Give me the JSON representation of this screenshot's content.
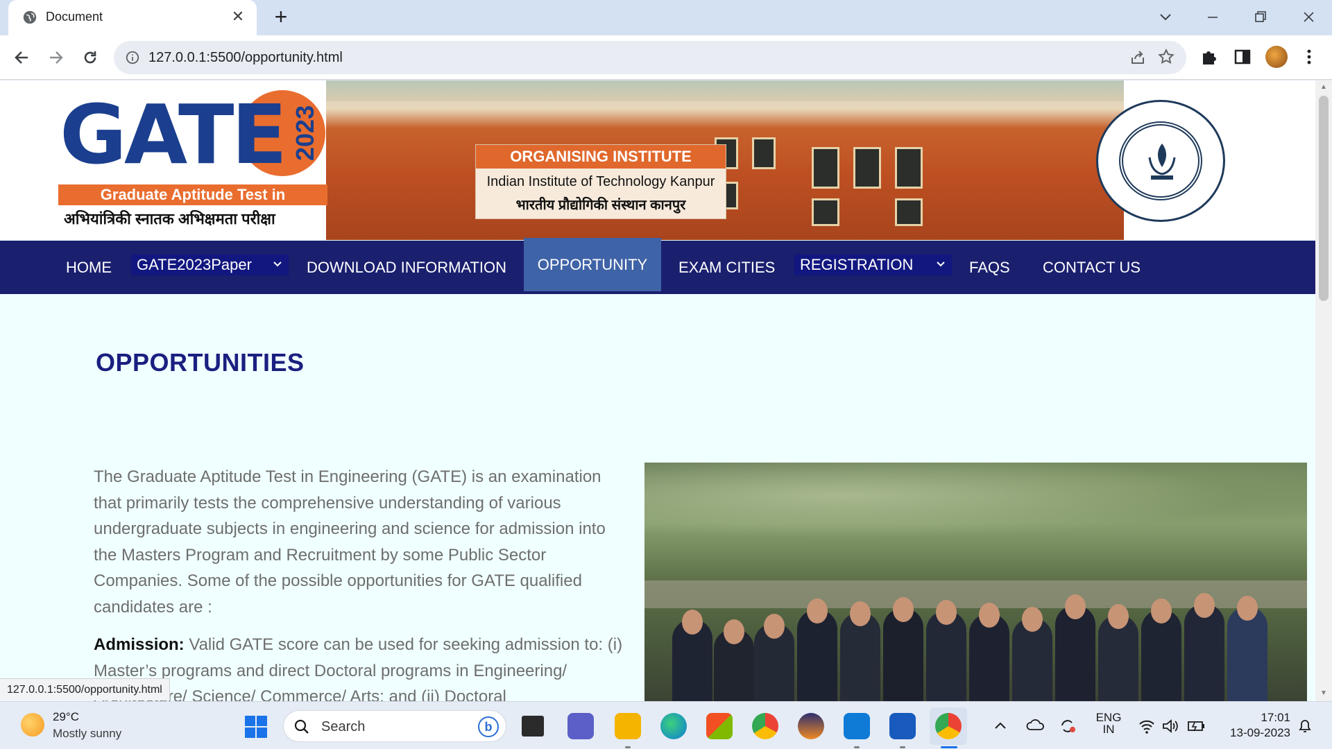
{
  "browser": {
    "tab_title": "Document",
    "url": "127.0.0.1:5500/opportunity.html",
    "status_url": "127.0.0.1:5500/opportunity.html"
  },
  "banner": {
    "logo_word": "GATE",
    "logo_year": "2023",
    "logo_subtitle": "Graduate Aptitude Test in Engineering",
    "logo_hindi": "अभियांत्रिकी स्नातक अभिक्षमता परीक्षा",
    "org_heading": "ORGANISING INSTITUTE",
    "org_name_en": "Indian Institute of Technology Kanpur",
    "org_name_hi": "भारतीय प्रौद्योगिकी संस्थान कानपुर"
  },
  "nav": {
    "home": "HOME",
    "paper": "GATE2023Paper",
    "download": "DOWNLOAD INFORMATION",
    "opportunity": "OPPORTUNITY",
    "cities": "EXAM CITIES",
    "registration": "REGISTRATION",
    "faqs": "FAQS",
    "contact": "CONTACT US"
  },
  "content": {
    "heading": "OPPORTUNITIES",
    "intro": "The Graduate Aptitude Test in Engineering (GATE) is an examination that primarily tests the comprehensive understanding of various undergraduate subjects in engineering and science for admission into the Masters Program and Recruitment by some Public Sector Companies. Some of the possible opportunities for GATE qualified candidates are :",
    "admission_label": "Admission:",
    "admission_text": " Valid GATE score can be used for seeking admission to: (i) Master’s programs and direct Doctoral programs in Engineering/ Architecture/ Science/ Commerce/ Arts; and (ii) Doctoral"
  },
  "taskbar": {
    "weather_temp": "29°C",
    "weather_desc": "Mostly sunny",
    "search_label": "Search",
    "lang_top": "ENG",
    "lang_bottom": "IN",
    "time": "17:01",
    "date": "13-09-2023"
  },
  "colors": {
    "nav_bg": "#1a1f6e",
    "nav_active": "#3f63a7",
    "heading": "#1a1f80",
    "page_bg": "#f0ffff",
    "accent_orange": "#e96d2f"
  }
}
